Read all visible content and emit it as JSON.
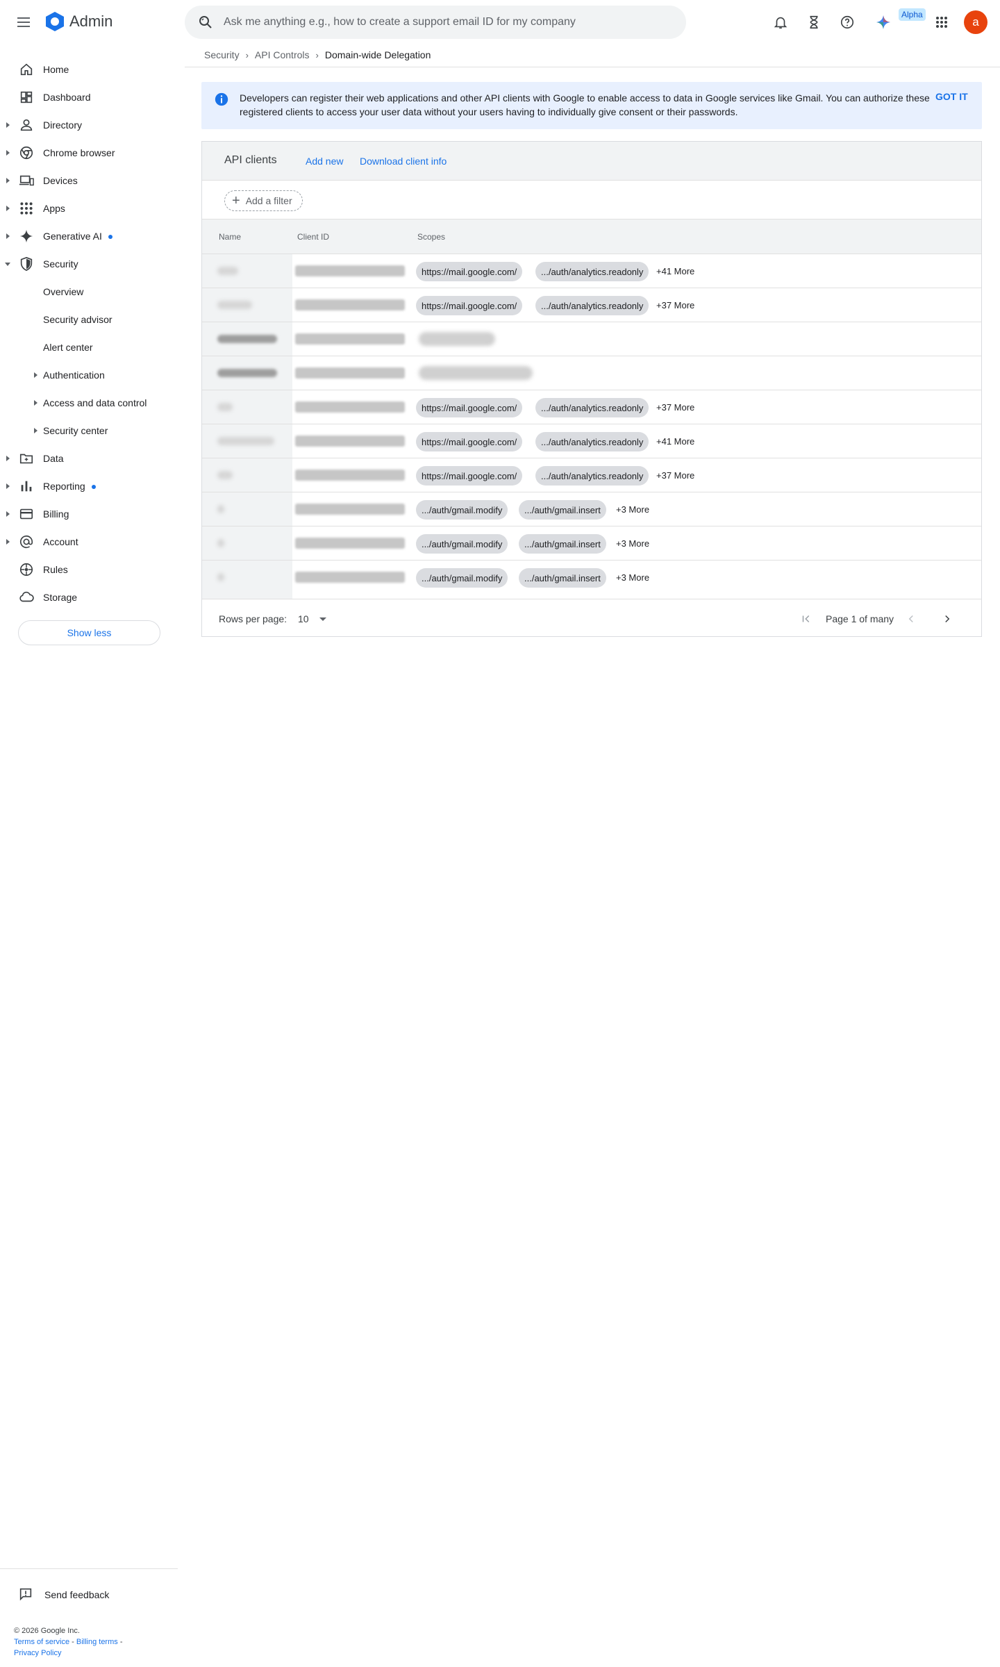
{
  "header": {
    "app_title": "Admin",
    "search_placeholder": "Ask me anything e.g., how to create a support email ID for my company",
    "alpha_badge": "Alpha",
    "avatar_letter": "a"
  },
  "sidebar": {
    "items": [
      {
        "label": "Home",
        "icon": "home-icon"
      },
      {
        "label": "Dashboard",
        "icon": "dashboard-icon"
      },
      {
        "label": "Directory",
        "icon": "person-icon"
      },
      {
        "label": "Chrome browser",
        "icon": "chrome-icon"
      },
      {
        "label": "Devices",
        "icon": "devices-icon"
      },
      {
        "label": "Apps",
        "icon": "apps-grid-icon"
      },
      {
        "label": "Generative AI",
        "icon": "sparkle-icon"
      },
      {
        "label": "Security",
        "icon": "shield-icon"
      },
      {
        "label": "Data",
        "icon": "folder-icon"
      },
      {
        "label": "Reporting",
        "icon": "bar-chart-icon"
      },
      {
        "label": "Billing",
        "icon": "credit-card-icon"
      },
      {
        "label": "Account",
        "icon": "at-sign-icon"
      },
      {
        "label": "Rules",
        "icon": "rules-icon"
      },
      {
        "label": "Storage",
        "icon": "cloud-icon"
      }
    ],
    "security_sub": [
      {
        "label": "Overview"
      },
      {
        "label": "Security advisor"
      },
      {
        "label": "Alert center"
      },
      {
        "label": "Authentication"
      },
      {
        "label": "Access and data control"
      },
      {
        "label": "Security center"
      }
    ],
    "show_less": "Show less",
    "send_feedback": "Send feedback"
  },
  "footer": {
    "copyright": "© 2026 Google Inc.",
    "terms": "Terms of service",
    "billing_terms": "Billing terms",
    "privacy": "Privacy Policy",
    "separator": " - "
  },
  "breadcrumb": {
    "items": [
      "Security",
      "API Controls"
    ],
    "current": "Domain-wide Delegation",
    "separator": "›"
  },
  "banner": {
    "text": "Developers can register their web applications and other API clients with Google to enable access to data in Google services like Gmail. You can authorize these registered clients to access your user data without your users having to individually give consent or their passwords.",
    "action": "GOT IT"
  },
  "card": {
    "title": "API clients",
    "add_new": "Add new",
    "download": "Download client info",
    "add_filter": "Add a filter",
    "columns": {
      "name": "Name",
      "client_id": "Client ID",
      "scopes": "Scopes"
    }
  },
  "rows": [
    {
      "scope1": "https://mail.google.com/",
      "scope2": ".../auth/analytics.readonly",
      "more": "+41 More"
    },
    {
      "scope1": "https://mail.google.com/",
      "scope2": ".../auth/analytics.readonly",
      "more": "+37 More"
    },
    {
      "scope1": "",
      "scope2": "",
      "more": ""
    },
    {
      "scope1": "",
      "scope2": "",
      "more": ""
    },
    {
      "scope1": "https://mail.google.com/",
      "scope2": ".../auth/analytics.readonly",
      "more": "+37 More"
    },
    {
      "scope1": "https://mail.google.com/",
      "scope2": ".../auth/analytics.readonly",
      "more": "+41 More"
    },
    {
      "scope1": "https://mail.google.com/",
      "scope2": ".../auth/analytics.readonly",
      "more": "+37 More"
    },
    {
      "scope1": ".../auth/gmail.modify",
      "scope2": ".../auth/gmail.insert",
      "more": "+3 More"
    },
    {
      "scope1": ".../auth/gmail.modify",
      "scope2": ".../auth/gmail.insert",
      "more": "+3 More"
    },
    {
      "scope1": ".../auth/gmail.modify",
      "scope2": ".../auth/gmail.insert",
      "more": "+3 More"
    }
  ],
  "pager": {
    "rows_per_page_label": "Rows per page:",
    "rows_per_page_value": "10",
    "page_info": "Page 1 of many"
  },
  "colors": {
    "accent": "#1a73e8",
    "avatar": "#e8430d",
    "banner_bg": "#e8f0fe"
  }
}
